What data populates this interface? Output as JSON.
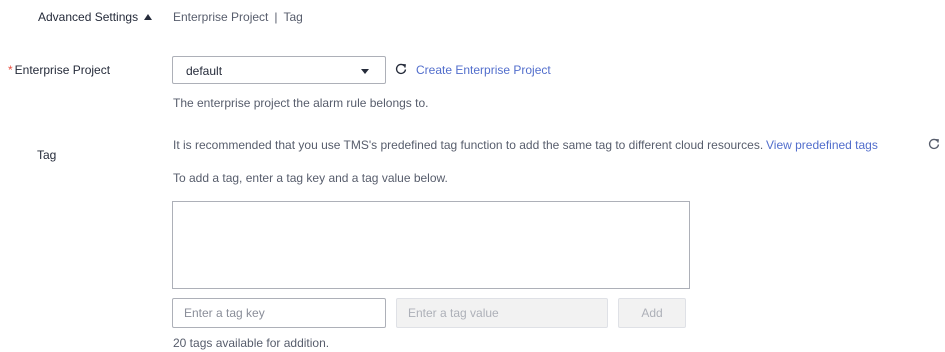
{
  "advanced": {
    "label": "Advanced Settings",
    "summary_items": [
      "Enterprise Project",
      "Tag"
    ],
    "summary_separator": "|"
  },
  "enterprise_project": {
    "required_mark": "*",
    "label": "Enterprise Project",
    "selected": "default",
    "create_link": "Create Enterprise Project",
    "hint": "The enterprise project the alarm rule belongs to."
  },
  "tag": {
    "label": "Tag",
    "recommend_text": "It is recommended that you use TMS's predefined tag function to add the same tag to different cloud resources.",
    "view_link": "View predefined tags",
    "instructions": "To add a tag, enter a tag key and a tag value below.",
    "key_placeholder": "Enter a tag key",
    "value_placeholder": "Enter a tag value",
    "add_label": "Add",
    "available_text": "20 tags available for addition."
  },
  "colors": {
    "link": "#526ecc",
    "required": "#e84e40",
    "text": "#252b3a",
    "muted": "#575d6c"
  },
  "icons": {
    "advanced_toggle": "caret-up-icon",
    "select_arrow": "caret-down-icon",
    "refresh": "refresh-icon"
  }
}
